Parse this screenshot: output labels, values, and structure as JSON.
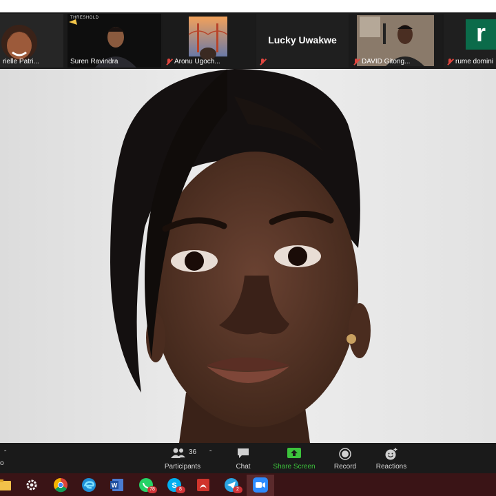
{
  "gallery": {
    "tiles": [
      {
        "name": "rielle Patri...",
        "muted": false
      },
      {
        "name": "Suren Ravindra",
        "muted": false,
        "overlay_text": "THRESHOLD"
      },
      {
        "name": "Aronu Ugoch...",
        "muted": true
      },
      {
        "name": "",
        "muted": true,
        "big_name": "Lucky Uwakwe"
      },
      {
        "name": "DAVID Gitong...",
        "muted": true
      },
      {
        "name": "rume domini",
        "muted": true,
        "initial": "r"
      }
    ]
  },
  "toolbar": {
    "participants_label": "Participants",
    "participants_count": "36",
    "chat_label": "Chat",
    "share_label": "Share Screen",
    "record_label": "Record",
    "reactions_label": "Reactions",
    "edge_label": "o",
    "share_color": "#3cc33c"
  },
  "taskbar": {
    "whatsapp_badge": "78",
    "skype_badge": "8",
    "telegram_badge": "2"
  }
}
